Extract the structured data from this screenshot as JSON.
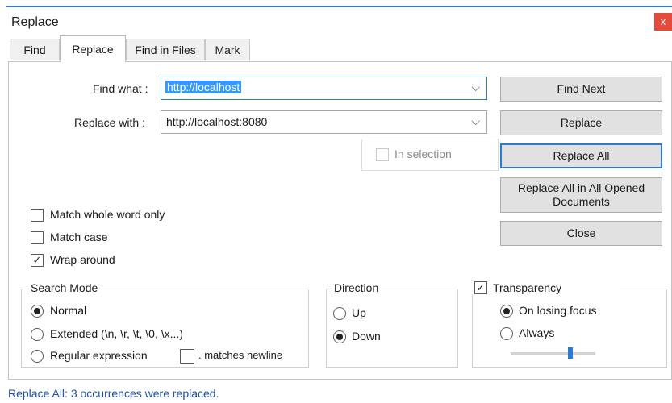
{
  "window": {
    "title": "Replace",
    "close_glyph": "x"
  },
  "tabs": [
    {
      "label": "Find"
    },
    {
      "label": "Replace"
    },
    {
      "label": "Find in Files"
    },
    {
      "label": "Mark"
    }
  ],
  "find": {
    "label": "Find what :",
    "value": "http://localhost"
  },
  "replace": {
    "label": "Replace with :",
    "value": "http://localhost:8080"
  },
  "dropdown_glyph": "⌵",
  "in_selection": {
    "label": "In selection",
    "checked": false
  },
  "buttons": {
    "find_next": "Find Next",
    "replace": "Replace",
    "replace_all": "Replace All",
    "replace_all_opened": "Replace All in All Opened Documents",
    "close": "Close"
  },
  "options": {
    "match_whole_word": {
      "label": "Match whole word only",
      "checked": false
    },
    "match_case": {
      "label": "Match case",
      "checked": false
    },
    "wrap_around": {
      "label": "Wrap around",
      "checked": true
    }
  },
  "search_mode": {
    "title": "Search Mode",
    "normal": "Normal",
    "extended": "Extended (\\n, \\r, \\t, \\0, \\x...)",
    "regex": "Regular expression",
    "dot_matches_newline": ". matches newline",
    "selected": "normal"
  },
  "direction": {
    "title": "Direction",
    "up": "Up",
    "down": "Down",
    "selected": "down"
  },
  "transparency": {
    "label": "Transparency",
    "checked": true,
    "on_losing_focus": "On losing focus",
    "always": "Always",
    "selected": "on_losing_focus",
    "slider_level": 0.7
  },
  "status": "Replace All: 3 occurrences were replaced.",
  "check_glyph": "✓"
}
